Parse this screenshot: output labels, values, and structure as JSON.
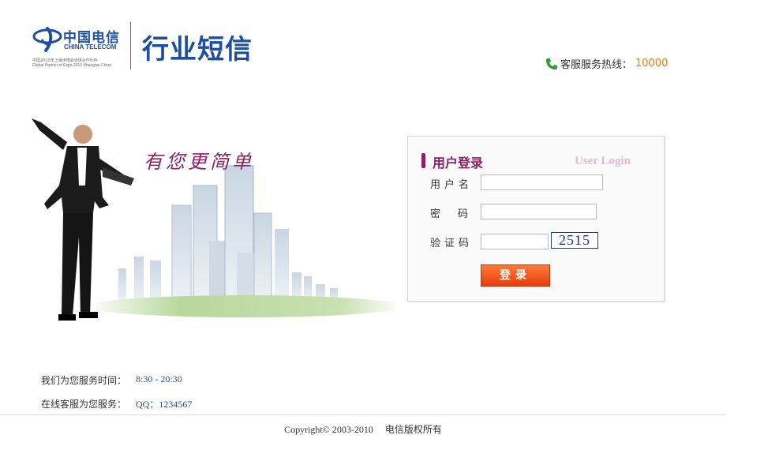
{
  "header": {
    "logo_cn": "中国电信",
    "logo_en": "CHINA TELECOM",
    "logo_sub1": "中国2010年上海世博会全球合作伙伴",
    "logo_sub2": "Global Partner of Expo 2010 Shanghai China",
    "product_title": "行业短信",
    "hotline_label": "客服服务热线：",
    "hotline_number": "10000"
  },
  "hero": {
    "slogan": "有您更简单"
  },
  "login": {
    "title": "用户登录",
    "title_en": "User Login",
    "username_label": "用户名",
    "password_label": "密码",
    "captcha_label": "验证码",
    "username_value": "",
    "password_value": "",
    "captcha_value": "",
    "captcha_code": "2515",
    "submit_label": "登录"
  },
  "service": {
    "hours_label": "我们为您服务时间：",
    "hours_value": "8:30 - 20:30",
    "online_label": "在线客服为您服务：",
    "online_value": "QQ：1234567"
  },
  "footer": {
    "copyright": "Copyright© 2003-2010",
    "owner": "电信版权所有"
  },
  "colors": {
    "brand_blue": "#1d4f9e",
    "accent_purple": "#8c1e66",
    "hotline_orange": "#f07800",
    "button_red": "#e53d0d"
  }
}
